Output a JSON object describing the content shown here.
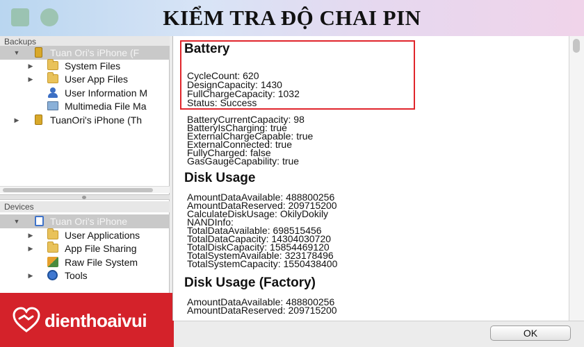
{
  "banner": {
    "title": "KIỂM TRA ĐỘ CHAI PIN"
  },
  "sidebar": {
    "backups_label": "Backups",
    "backups": [
      {
        "label": "Tuan Ori's iPhone (F",
        "icon": "phone-icon",
        "expanded": true,
        "selected": true
      },
      {
        "label": "System Files",
        "icon": "folder-icon"
      },
      {
        "label": "User App Files",
        "icon": "folder-icon"
      },
      {
        "label": "User Information M",
        "icon": "user-icon"
      },
      {
        "label": "Multimedia File Ma",
        "icon": "media-icon"
      },
      {
        "label": "TuanOri's iPhone (Th",
        "icon": "phone-icon"
      }
    ],
    "devices_label": "Devices",
    "devices": [
      {
        "label": "Tuan Ori's iPhone",
        "icon": "device-icon",
        "expanded": true,
        "selected": true
      },
      {
        "label": "User Applications",
        "icon": "folder-icon"
      },
      {
        "label": "App File Sharing",
        "icon": "folder-icon"
      },
      {
        "label": "Raw File System",
        "icon": "raw-file-system-icon"
      },
      {
        "label": "Tools",
        "icon": "tools-icon"
      }
    ]
  },
  "logo": {
    "text": "dienthoaivui"
  },
  "detail": {
    "battery": {
      "heading": "Battery",
      "lines": [
        "CycleCount: 620",
        "DesignCapacity: 1430",
        "FullChargeCapacity: 1032",
        "Status: Success"
      ],
      "more": [
        "BatteryCurrentCapacity: 98",
        "BatteryIsCharging: true",
        "ExternalChargeCapable: true",
        "ExternalConnected: true",
        "FullyCharged: false",
        "GasGaugeCapability: true"
      ]
    },
    "disk": {
      "heading": "Disk Usage",
      "lines": [
        "AmountDataAvailable: 488800256",
        "AmountDataReserved: 209715200",
        "CalculateDiskUsage: OkilyDokily",
        "NANDInfo:",
        "TotalDataAvailable: 698515456",
        "TotalDataCapacity: 14304030720",
        "TotalDiskCapacity: 15854469120",
        "TotalSystemAvailable: 323178496",
        "TotalSystemCapacity: 1550438400"
      ]
    },
    "disk_factory": {
      "heading": "Disk Usage (Factory)",
      "lines": [
        "AmountDataAvailable: 488800256",
        "AmountDataReserved: 209715200"
      ]
    }
  },
  "footer": {
    "ok_label": "OK"
  },
  "colors": {
    "highlight": "#e0252b",
    "logo_bg": "#d4222a",
    "selection": "#c9c9c9"
  }
}
